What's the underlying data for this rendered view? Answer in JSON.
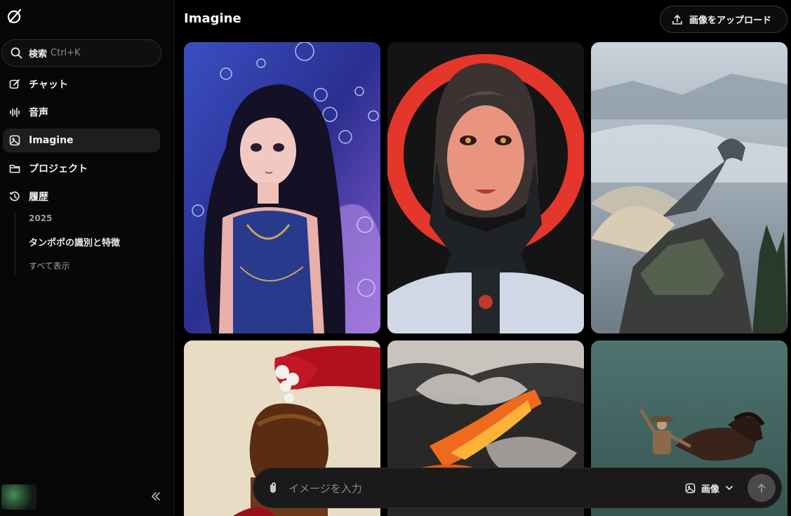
{
  "sidebar": {
    "search": {
      "label": "検索",
      "shortcut": "Ctrl+K"
    },
    "nav": [
      {
        "label": "チャット",
        "icon": "edit-icon"
      },
      {
        "label": "音声",
        "icon": "voice-wave-icon"
      },
      {
        "label": "Imagine",
        "icon": "image-icon",
        "active": true
      },
      {
        "label": "プロジェクト",
        "icon": "folder-icon"
      },
      {
        "label": "履歴",
        "icon": "history-icon"
      }
    ],
    "history": {
      "year": "2025",
      "items": [
        "タンポポの識別と特徴"
      ],
      "show_all": "すべて表示"
    }
  },
  "main": {
    "title": "Imagine",
    "upload_label": "画像をアップロード",
    "gallery": [
      {
        "subject": "anime girl with bubbles"
      },
      {
        "subject": "cyborg woman with red halo"
      },
      {
        "subject": "dragon on cliff in mist"
      },
      {
        "subject": "red-gloved hand with chocolate dessert"
      },
      {
        "subject": "erupting volcano with lava"
      },
      {
        "subject": "cowboy on horseback"
      }
    ]
  },
  "composer": {
    "placeholder": "イメージを入力",
    "mode_label": "画像"
  },
  "colors": {
    "background": "#000000",
    "sidebar": "#070707",
    "active_item": "#1e1e1e",
    "composer": "#1a1a1a"
  }
}
